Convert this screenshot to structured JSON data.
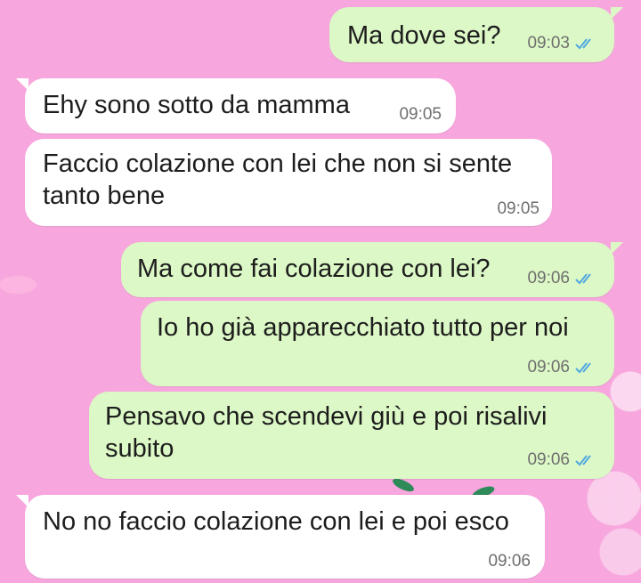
{
  "colors": {
    "wallpaper": "#f7a7dd",
    "outgoing_bubble": "#dcf8c6",
    "incoming_bubble": "#ffffff",
    "read_ticks": "#4fa8e0"
  },
  "messages": [
    {
      "direction": "outgoing",
      "text": "Ma dove sei?",
      "time": "09:03",
      "status_icon": "double-check-read-icon"
    },
    {
      "direction": "incoming",
      "text": "Ehy sono sotto da mamma",
      "time": "09:05"
    },
    {
      "direction": "incoming",
      "text": "Faccio colazione con lei che non si sente\ntanto bene",
      "time": "09:05"
    },
    {
      "direction": "outgoing",
      "text": "Ma come fai colazione con lei?",
      "time": "09:06",
      "status_icon": "double-check-read-icon"
    },
    {
      "direction": "outgoing",
      "text": "Io ho già apparecchiato tutto per noi",
      "time": "09:06",
      "status_icon": "double-check-read-icon"
    },
    {
      "direction": "outgoing",
      "text": "Pensavo che scendevi giù e poi risalivi\nsubito",
      "time": "09:06",
      "status_icon": "double-check-read-icon"
    },
    {
      "direction": "incoming",
      "text": "No no faccio colazione con lei e poi esco",
      "time": "09:06"
    }
  ]
}
